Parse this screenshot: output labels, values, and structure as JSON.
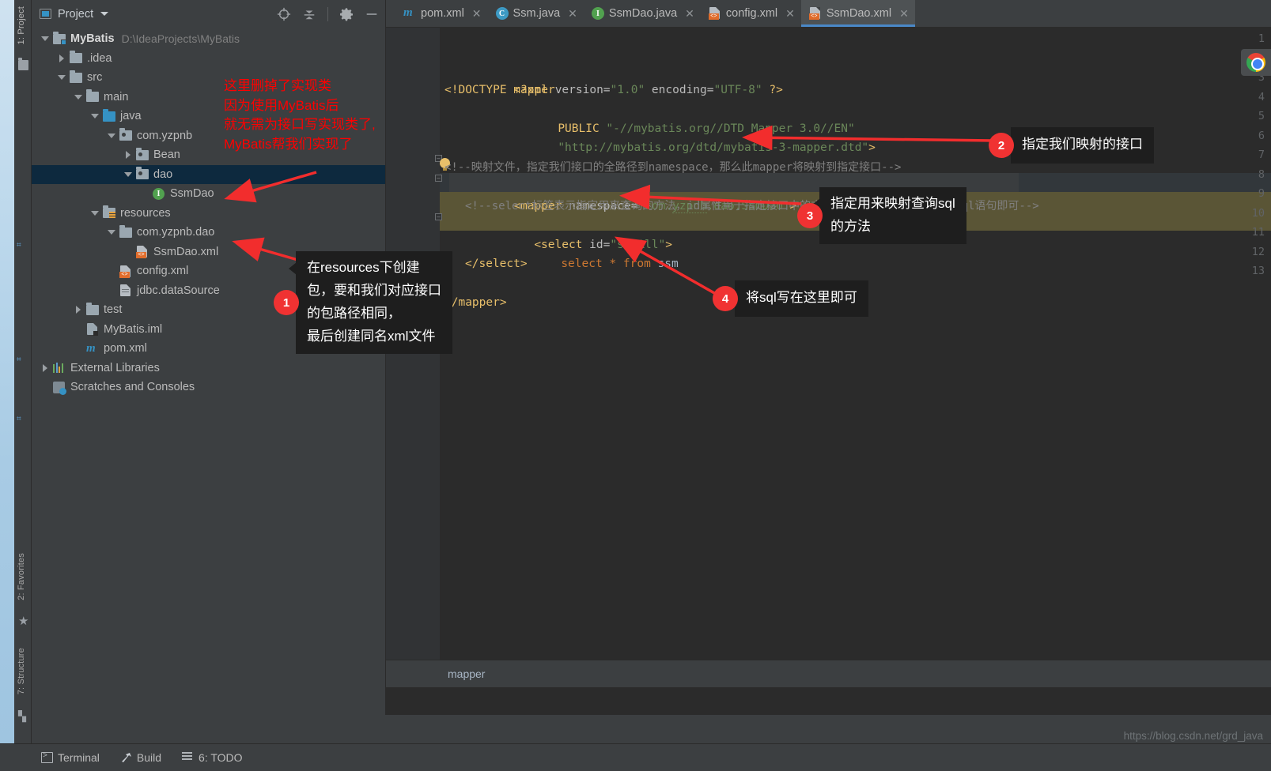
{
  "window": {
    "tool_strip": {
      "project_label": "1: Project",
      "favorites_label": "2: Favorites",
      "structure_label": "7: Structure"
    }
  },
  "project_panel": {
    "title": "Project",
    "actions": [
      {
        "name": "locate-icon",
        "label": "Select Opened File"
      },
      {
        "name": "collapse-all-icon",
        "label": "Collapse All"
      },
      {
        "name": "gear-icon",
        "label": "Settings"
      },
      {
        "name": "minimize-icon",
        "label": "Hide"
      }
    ],
    "tree": [
      {
        "label": "MyBatis",
        "path": "D:\\IdeaProjects\\MyBatis",
        "indent": 0,
        "twist": "open",
        "icon": "module-folder",
        "bold": true,
        "selected": false
      },
      {
        "label": ".idea",
        "path": "",
        "indent": 1,
        "twist": "closed",
        "icon": "folder-grey",
        "bold": false,
        "selected": false
      },
      {
        "label": "src",
        "path": "",
        "indent": 1,
        "twist": "open",
        "icon": "folder-grey",
        "bold": false,
        "selected": false
      },
      {
        "label": "main",
        "path": "",
        "indent": 2,
        "twist": "open",
        "icon": "folder-grey",
        "bold": false,
        "selected": false
      },
      {
        "label": "java",
        "path": "",
        "indent": 3,
        "twist": "open",
        "icon": "folder-blue",
        "bold": false,
        "selected": false
      },
      {
        "label": "com.yzpnb",
        "path": "",
        "indent": 4,
        "twist": "open",
        "icon": "package",
        "bold": false,
        "selected": false
      },
      {
        "label": "Bean",
        "path": "",
        "indent": 5,
        "twist": "closed",
        "icon": "package",
        "bold": false,
        "selected": false
      },
      {
        "label": "dao",
        "path": "",
        "indent": 5,
        "twist": "open",
        "icon": "package",
        "bold": false,
        "selected": true
      },
      {
        "label": "SsmDao",
        "path": "",
        "indent": 6,
        "twist": "none",
        "icon": "interface",
        "bold": false,
        "selected": false
      },
      {
        "label": "resources",
        "path": "",
        "indent": 3,
        "twist": "open",
        "icon": "folder-resources",
        "bold": false,
        "selected": false
      },
      {
        "label": "com.yzpnb.dao",
        "path": "",
        "indent": 4,
        "twist": "open",
        "icon": "folder-grey",
        "bold": false,
        "selected": false
      },
      {
        "label": "SsmDao.xml",
        "path": "",
        "indent": 5,
        "twist": "none",
        "icon": "xml-file",
        "bold": false,
        "selected": false
      },
      {
        "label": "config.xml",
        "path": "",
        "indent": 4,
        "twist": "none",
        "icon": "xml-file",
        "bold": false,
        "selected": false
      },
      {
        "label": "jdbc.dataSource",
        "path": "",
        "indent": 4,
        "twist": "none",
        "icon": "text-file",
        "bold": false,
        "selected": false
      },
      {
        "label": "test",
        "path": "",
        "indent": 2,
        "twist": "closed",
        "icon": "folder-grey",
        "bold": false,
        "selected": false
      },
      {
        "label": "MyBatis.iml",
        "path": "",
        "indent": 2,
        "twist": "none",
        "icon": "iml-file",
        "bold": false,
        "selected": false
      },
      {
        "label": "pom.xml",
        "path": "",
        "indent": 2,
        "twist": "none",
        "icon": "maven-file",
        "bold": false,
        "selected": false
      },
      {
        "label": "External Libraries",
        "path": "",
        "indent": 0,
        "twist": "closed",
        "icon": "library",
        "bold": false,
        "selected": false
      },
      {
        "label": "Scratches and Consoles",
        "path": "",
        "indent": 0,
        "twist": "none",
        "icon": "scratches",
        "bold": false,
        "selected": false
      }
    ]
  },
  "editor": {
    "tabs": [
      {
        "label": "pom.xml",
        "icon": "maven-icon",
        "active": false
      },
      {
        "label": "Ssm.java",
        "icon": "class-icon",
        "active": false
      },
      {
        "label": "SsmDao.java",
        "icon": "interface-icon",
        "active": false
      },
      {
        "label": "config.xml",
        "icon": "xml-icon",
        "active": false
      },
      {
        "label": "SsmDao.xml",
        "icon": "xml-icon",
        "active": true
      }
    ],
    "line_numbers": [
      "1",
      "2",
      "3",
      "4",
      "5",
      "6",
      "7",
      "8",
      "9",
      "10",
      "11",
      "12",
      "13"
    ],
    "code": {
      "l1_a": "<?xml ",
      "l1_b": "version=",
      "l1_c": "\"1.0\"",
      "l1_d": " encoding=",
      "l1_e": "\"UTF-8\"",
      "l1_f": " ?>",
      "l2": "<!DOCTYPE mapper",
      "l3_a": "PUBLIC ",
      "l3_b": "\"-//mybatis.org//DTD Mapper 3.0//EN\"",
      "l4_a": "\"http://mybatis.org/dtd/mybatis-3-mapper.dtd\"",
      "l4_b": ">",
      "l6": "<!--映射文件，指定我们接口的全路径到namespace，那么此mapper将映射到指定接口-->",
      "l7_a": "<mapper ",
      "l7_b": "namespace=",
      "l7_c": "\"com.",
      "l7_d": "yzpnb",
      "l7_e": ".dao.SsmDao\"",
      "l7_f": ">",
      "l8": "<!--select标签表示指定用来查询的方法，id属性用于指定接口中的方法名，内部写我们要执行的sql语句即可-->",
      "l9_a": "<select ",
      "l9_b": "id=",
      "l9_c": "\"selAll\"",
      "l9_d": ">",
      "l10_a": "select ",
      "l10_b": "* ",
      "l10_c": "from ",
      "l10_d": "ssm",
      "l11": "</select>",
      "l13": "</mapper>"
    },
    "breadcrumb": "mapper"
  },
  "annotations": {
    "red_note": "这里删掉了实现类\n因为使用MyBatis后\n就无需为接口写实现类了,\nMyBatis帮我们实现了",
    "callouts": [
      {
        "num": "1",
        "text": "在resources下创建\n包，要和我们对应接口\n的包路径相同，\n最后创建同名xml文件"
      },
      {
        "num": "2",
        "text": "指定我们映射的接口"
      },
      {
        "num": "3",
        "text": "指定用来映射查询sql\n的方法"
      },
      {
        "num": "4",
        "text": "将sql写在这里即可"
      }
    ]
  },
  "status_bar": {
    "items": [
      {
        "label": "Terminal",
        "icon": "terminal-icon"
      },
      {
        "label": "Build",
        "icon": "hammer-icon"
      },
      {
        "label": "6: TODO",
        "icon": "todo-icon"
      }
    ]
  },
  "watermark": "https://blog.csdn.net/grd_java",
  "colors": {
    "accent_blue": "#4a88c7",
    "selection_blue": "#0d293e",
    "annotation_red": "#ff0000",
    "callout_red": "#f03232",
    "panel_bg": "#3c3f41",
    "editor_bg": "#2b2b2b"
  }
}
